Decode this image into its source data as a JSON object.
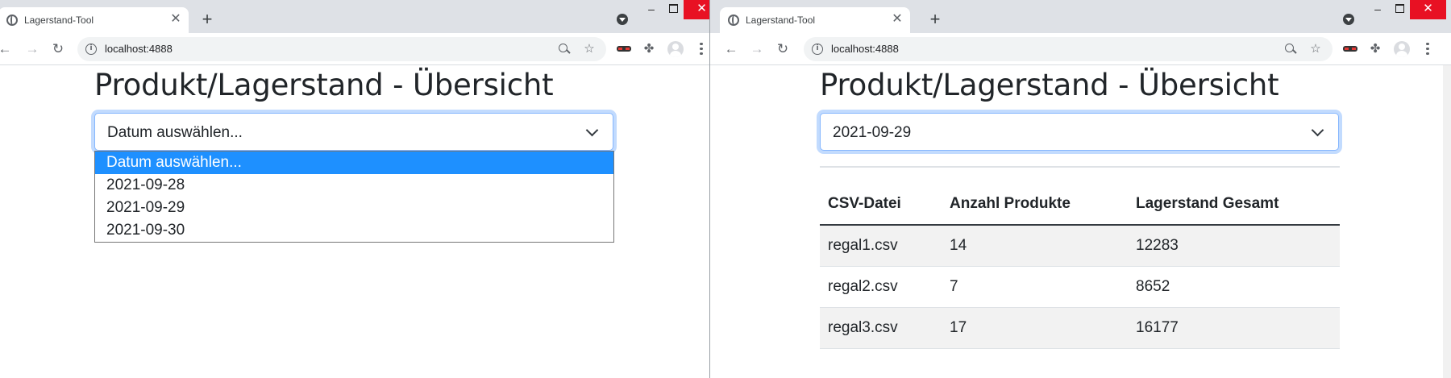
{
  "windows": [
    {
      "tab_title": "Lagerstand-Tool",
      "url": "localhost:4888",
      "heading": "Produkt/Lagerstand - Übersicht",
      "select_value": "Datum auswählen...",
      "dropdown_options": [
        "Datum auswählen...",
        "2021-09-28",
        "2021-09-29",
        "2021-09-30"
      ],
      "highlighted_option": "Datum auswählen..."
    },
    {
      "tab_title": "Lagerstand-Tool",
      "url": "localhost:4888",
      "heading": "Produkt/Lagerstand - Übersicht",
      "select_value": "2021-09-29",
      "table": {
        "headers": [
          "CSV-Datei",
          "Anzahl Produkte",
          "Lagerstand Gesamt"
        ],
        "rows": [
          [
            "regal1.csv",
            "14",
            "12283"
          ],
          [
            "regal2.csv",
            "7",
            "8652"
          ],
          [
            "regal3.csv",
            "17",
            "16177"
          ]
        ]
      }
    }
  ],
  "icons": {
    "tab_favicon": "globe-icon",
    "tab_close": "close-icon",
    "new_tab": "plus-icon",
    "tab_search": "tab-search-icon",
    "back": "back-arrow-icon",
    "forward": "forward-arrow-icon",
    "reload": "reload-icon",
    "site_info": "info-icon",
    "zoom": "zoom-icon",
    "bookmark": "star-icon",
    "extension_1": "mask-extension-icon",
    "extensions": "puzzle-icon",
    "profile": "avatar-icon",
    "menu": "kebab-menu-icon",
    "dropdown": "chevron-down-icon"
  },
  "colors": {
    "highlight": "#1e90ff",
    "focus_border": "#86b7fe",
    "close_button": "#e81123",
    "tabstrip": "#dee1e6",
    "stripe": "#f2f2f2"
  }
}
